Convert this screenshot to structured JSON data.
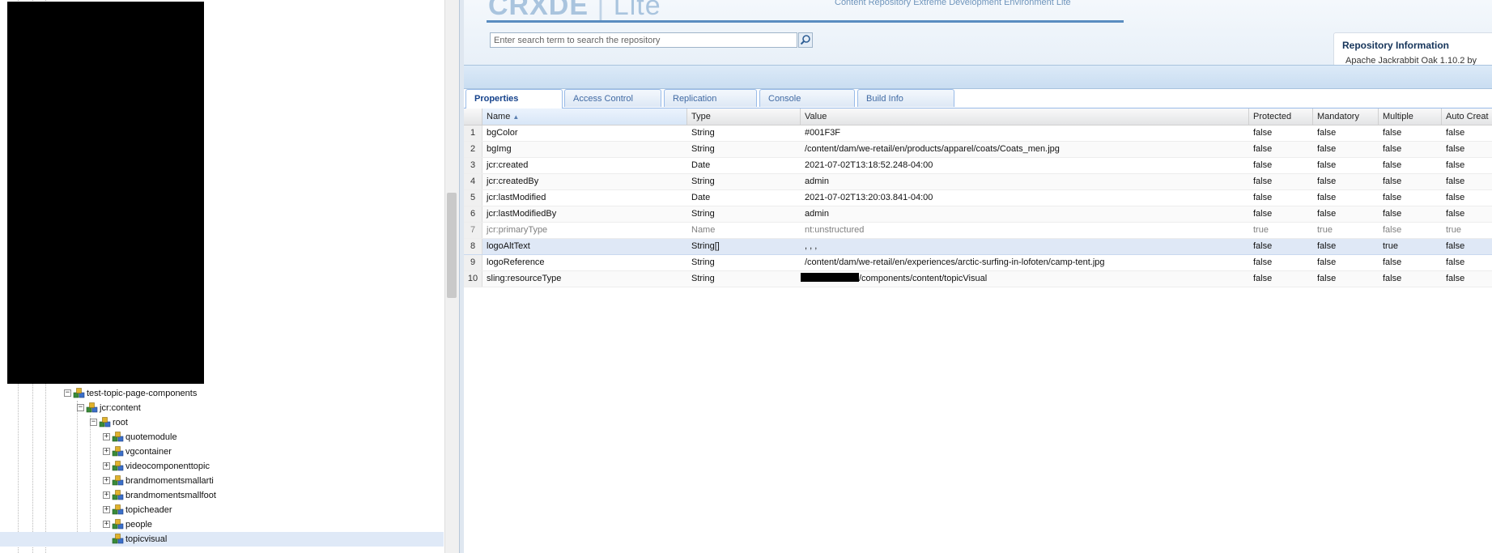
{
  "tree": {
    "nodes": [
      {
        "label": "test-topic-page-components",
        "toggle": "−"
      },
      {
        "label": "jcr:content",
        "toggle": "−"
      },
      {
        "label": "root",
        "toggle": "−"
      },
      {
        "label": "quotemodule",
        "toggle": "+"
      },
      {
        "label": "vgcontainer",
        "toggle": "+"
      },
      {
        "label": "videocomponenttopic",
        "toggle": "+"
      },
      {
        "label": "brandmomentsmallarti",
        "toggle": "+"
      },
      {
        "label": "brandmomentsmallfoot",
        "toggle": "+"
      },
      {
        "label": "topicheader",
        "toggle": "+"
      },
      {
        "label": "people",
        "toggle": "+"
      },
      {
        "label": "topicvisual",
        "toggle": ""
      }
    ],
    "selected": "topicvisual"
  },
  "header": {
    "logo_main": "CRXDE",
    "logo_sep": "|",
    "logo_lite": "Lite",
    "tagline": "Content Repository Extreme Development Environment Lite",
    "search_placeholder": "Enter search term to search the repository",
    "repo_info_title": "Repository Information",
    "repo_info_version": "Apache Jackrabbit Oak 1.10.2 by"
  },
  "tabs": [
    "Properties",
    "Access Control",
    "Replication",
    "Console",
    "Build Info"
  ],
  "active_tab": "Properties",
  "grid": {
    "columns": [
      "Name",
      "Type",
      "Value",
      "Protected",
      "Mandatory",
      "Multiple",
      "Auto Creat"
    ],
    "sorted_column": "Name",
    "rows": [
      {
        "num": "1",
        "name": "bgColor",
        "type": "String",
        "value": "#001F3F",
        "protected": "false",
        "mandatory": "false",
        "multiple": "false",
        "auto": "false"
      },
      {
        "num": "2",
        "name": "bgImg",
        "type": "String",
        "value": "/content/dam/we-retail/en/products/apparel/coats/Coats_men.jpg",
        "protected": "false",
        "mandatory": "false",
        "multiple": "false",
        "auto": "false"
      },
      {
        "num": "3",
        "name": "jcr:created",
        "type": "Date",
        "value": "2021-07-02T13:18:52.248-04:00",
        "protected": "false",
        "mandatory": "false",
        "multiple": "false",
        "auto": "false"
      },
      {
        "num": "4",
        "name": "jcr:createdBy",
        "type": "String",
        "value": "admin",
        "protected": "false",
        "mandatory": "false",
        "multiple": "false",
        "auto": "false"
      },
      {
        "num": "5",
        "name": "jcr:lastModified",
        "type": "Date",
        "value": "2021-07-02T13:20:03.841-04:00",
        "protected": "false",
        "mandatory": "false",
        "multiple": "false",
        "auto": "false"
      },
      {
        "num": "6",
        "name": "jcr:lastModifiedBy",
        "type": "String",
        "value": "admin",
        "protected": "false",
        "mandatory": "false",
        "multiple": "false",
        "auto": "false"
      },
      {
        "num": "7",
        "name": "jcr:primaryType",
        "type": "Name",
        "value": "nt:unstructured",
        "protected": "true",
        "mandatory": "true",
        "multiple": "false",
        "auto": "true"
      },
      {
        "num": "8",
        "name": "logoAltText",
        "type": "String[]",
        "value": ", , ,",
        "protected": "false",
        "mandatory": "false",
        "multiple": "true",
        "auto": "false"
      },
      {
        "num": "9",
        "name": "logoReference",
        "type": "String",
        "value": "/content/dam/we-retail/en/experiences/arctic-surfing-in-lofoten/camp-tent.jpg",
        "protected": "false",
        "mandatory": "false",
        "multiple": "false",
        "auto": "false"
      },
      {
        "num": "10",
        "name": "sling:resourceType",
        "type": "String",
        "value": "/components/content/topicVisual",
        "protected": "false",
        "mandatory": "false",
        "multiple": "false",
        "auto": "false"
      }
    ],
    "selected_row": "8",
    "dim_row": "7"
  },
  "colors": {
    "accent": "#15428b",
    "tab_text": "#416aa3",
    "selection": "#dfe8f6",
    "header_rule": "#5a8dc0"
  }
}
